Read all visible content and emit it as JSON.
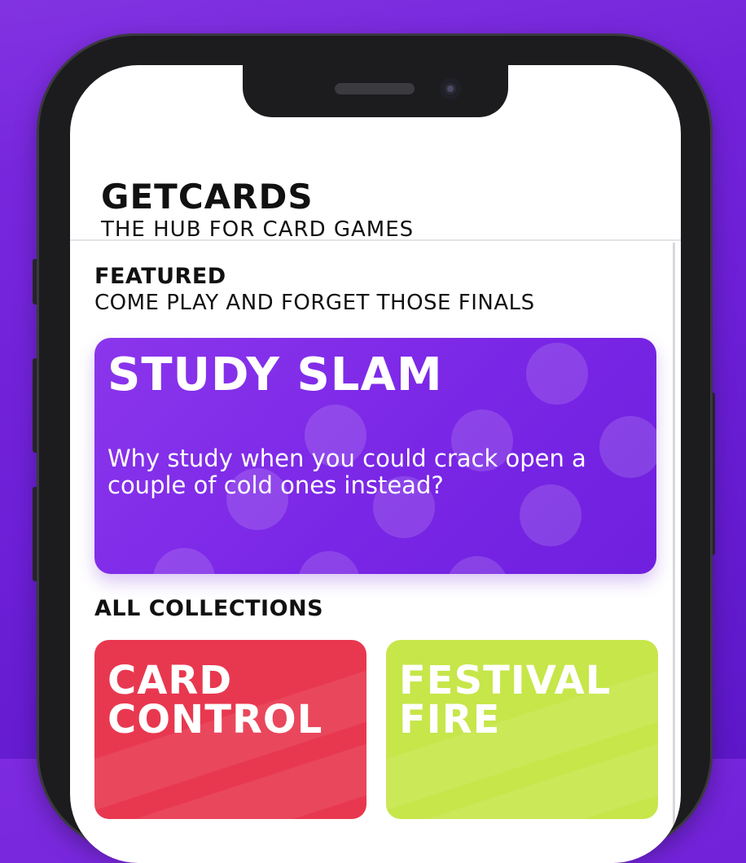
{
  "app": {
    "title": "GETCARDS",
    "subtitle": "THE HUB FOR CARD GAMES"
  },
  "featured": {
    "section_title": "FEATURED",
    "section_subtitle": "COME PLAY AND FORGET THOSE FINALS",
    "card": {
      "title": "STUDY SLAM",
      "description": "Why study when you could crack open a couple of cold ones instead?",
      "color": "#7a26e6"
    }
  },
  "collections": {
    "section_title": "ALL COLLECTIONS",
    "items": [
      {
        "title": "CARD CONTROL",
        "color": "#e8384f"
      },
      {
        "title": "FESTIVAL FIRE",
        "color": "#c6e64a"
      }
    ]
  },
  "colors": {
    "background": "#6c1fd6",
    "phone_frame": "#1c1c1f",
    "screen": "#ffffff"
  }
}
